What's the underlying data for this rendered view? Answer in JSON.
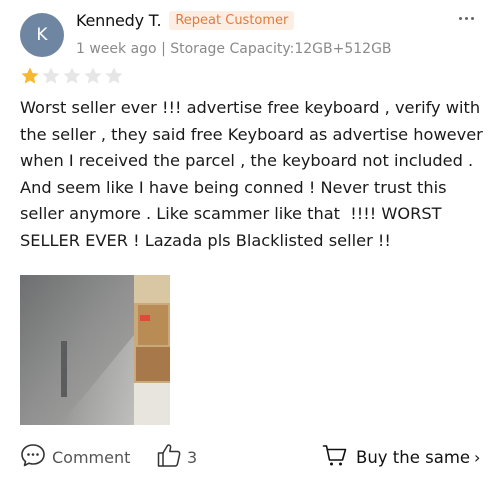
{
  "reviewer": {
    "avatar_initial": "K",
    "name": "Kennedy T.",
    "badge": "Repeat Customer",
    "meta": "1 week ago | Storage Capacity:12GB+512GB"
  },
  "rating": {
    "stars": 1,
    "max": 5,
    "filled_color": "#f5b82e",
    "empty_color": "#e6e6e6"
  },
  "review_text": "Worst seller ever !!! advertise free keyboard , verify with the seller , they said free Keyboard as advertise however when I received the parcel , the keyboard not included . And seem like I have being conned ! Never trust this seller anymore . Like scammer like that  !!!! WORST SELLER EVER ! Lazada pls Blacklisted seller !!",
  "actions": {
    "comment_label": "Comment",
    "like_count": "3",
    "buy_label": "Buy the same",
    "buy_chevron": "›"
  },
  "icons": {
    "more": "more-icon",
    "comment": "comment-icon",
    "like": "thumbs-up-icon",
    "cart": "cart-icon"
  },
  "colors": {
    "avatar_bg": "#6f86a3",
    "badge_bg": "#fdeee4",
    "badge_text": "#e17b3c",
    "meta_text": "#8a8a8a"
  }
}
